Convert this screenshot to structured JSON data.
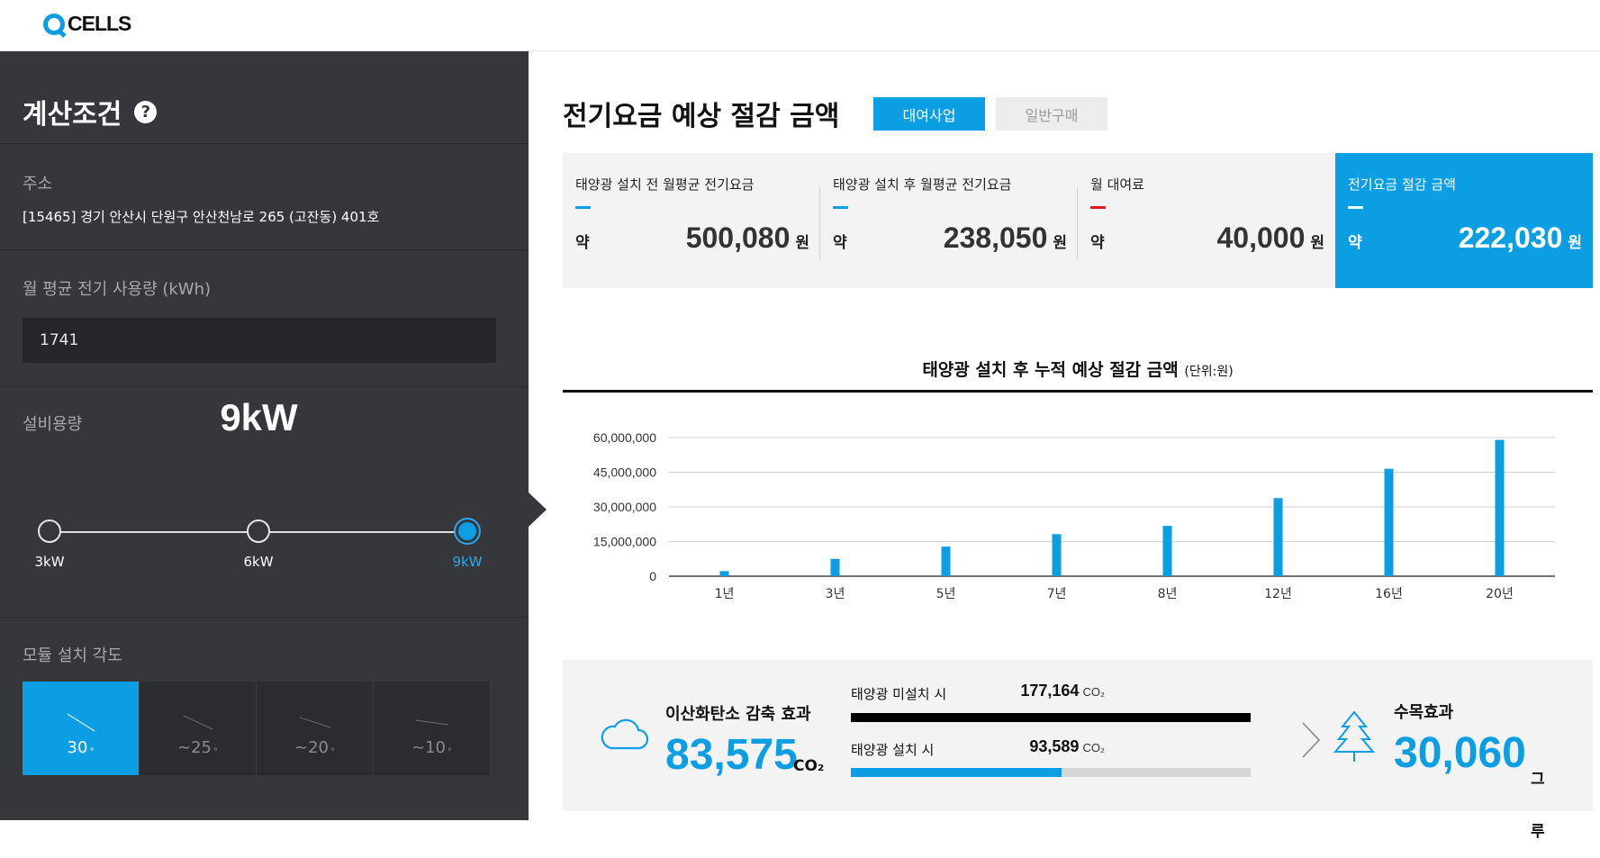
{
  "header": {
    "logo_text": "CELLS"
  },
  "sidebar": {
    "title": "계산조건",
    "help_glyph": "?",
    "address_label": "주소",
    "address_value": "[15465] 경기 안산시 단원구 안산천남로 265 (고잔동) 401호",
    "usage_label": "월 평균 전기 사용량 (kWh)",
    "usage_value": "1741",
    "capacity_label": "설비용량",
    "capacity_value": "9kW",
    "capacity_options": [
      "3kW",
      "6kW",
      "9kW"
    ],
    "capacity_selected": "9kW",
    "angle_label": "모듈 설치 각도",
    "angle_options": [
      {
        "label": "30",
        "active": true
      },
      {
        "label": "~25",
        "active": false
      },
      {
        "label": "~20",
        "active": false
      },
      {
        "label": "~10",
        "active": false
      }
    ],
    "angle_degree_symbol": "°"
  },
  "main": {
    "title": "전기요금 예상 절감 금액",
    "tabs": [
      {
        "label": "대여사업",
        "active": true
      },
      {
        "label": "일반구매",
        "active": false
      }
    ],
    "summary": [
      {
        "title": "태양광 설치 전 월평균 전기요금",
        "prefix": "약",
        "value": "500,080",
        "unit": "원",
        "dash_color": "#0b9ee3"
      },
      {
        "title": "태양광 설치 후 월평균 전기요금",
        "prefix": "약",
        "value": "238,050",
        "unit": "원",
        "dash_color": "#0b9ee3"
      },
      {
        "title": "월 대여료",
        "prefix": "약",
        "value": "40,000",
        "unit": "원",
        "dash_color": "#e5161b"
      },
      {
        "title": "전기요금 절감 금액",
        "prefix": "약",
        "value": "222,030",
        "unit": "원",
        "dash_color": "#ffffff"
      }
    ],
    "chart_title": "태양광 설치 후 누적 예상 절감 금액",
    "chart_unit": "(단위:원)"
  },
  "chart_data": {
    "type": "bar",
    "categories": [
      "1년",
      "3년",
      "5년",
      "7년",
      "8년",
      "12년",
      "16년",
      "20년"
    ],
    "values": [
      2200000,
      7500000,
      12800000,
      18200000,
      21800000,
      33800000,
      46500000,
      59000000
    ],
    "ylim": [
      0,
      60000000
    ],
    "yticks": [
      0,
      15000000,
      30000000,
      45000000,
      60000000
    ],
    "ytick_labels": [
      "0",
      "15,000,000",
      "30,000,000",
      "45,000,000",
      "60,000,000"
    ],
    "grid": true,
    "bar_color": "#0b9ee3"
  },
  "co2": {
    "label": "이산화탄소 감축 효과",
    "value": "83,575",
    "unit": "CO₂",
    "bars": [
      {
        "label": "태양광 미설치 시",
        "value": "177,164",
        "unit": "CO₂",
        "fraction": 1.0,
        "color": "#000000"
      },
      {
        "label": "태양광 설치 시",
        "value": "93,589",
        "unit": "CO₂",
        "fraction": 0.528,
        "color": "#0b9ee3"
      }
    ],
    "tree_label": "수목효과",
    "tree_value": "30,060",
    "tree_unit": "그루"
  }
}
